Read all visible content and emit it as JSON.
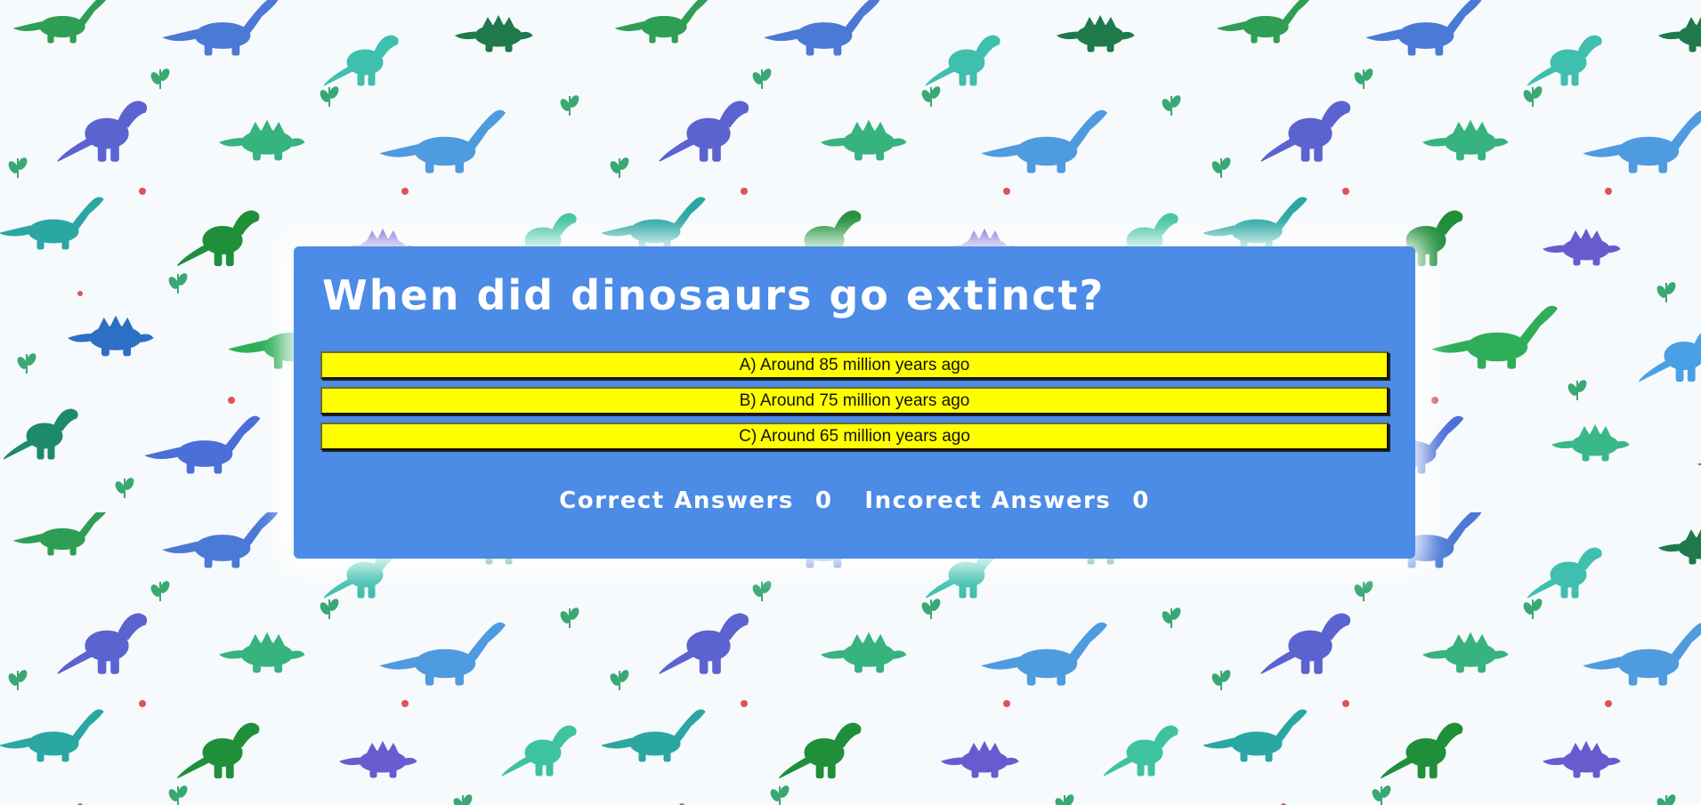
{
  "quiz": {
    "question": "When did dinosaurs go extinct?",
    "answers": [
      {
        "label": "A) Around 85 million years ago"
      },
      {
        "label": "B) Around 75 million years ago"
      },
      {
        "label": "C) Around 65 million years ago"
      }
    ]
  },
  "score": {
    "correct_label": "Correct Answers",
    "correct_count": "0",
    "incorrect_label": "Incorect Answers",
    "incorrect_count": "0"
  },
  "colors": {
    "card_background": "#4c8be6",
    "answer_background": "#ffff00",
    "text_light": "#ffffff"
  },
  "background": {
    "pattern": "watercolor-dinosaur-tile-icon"
  }
}
